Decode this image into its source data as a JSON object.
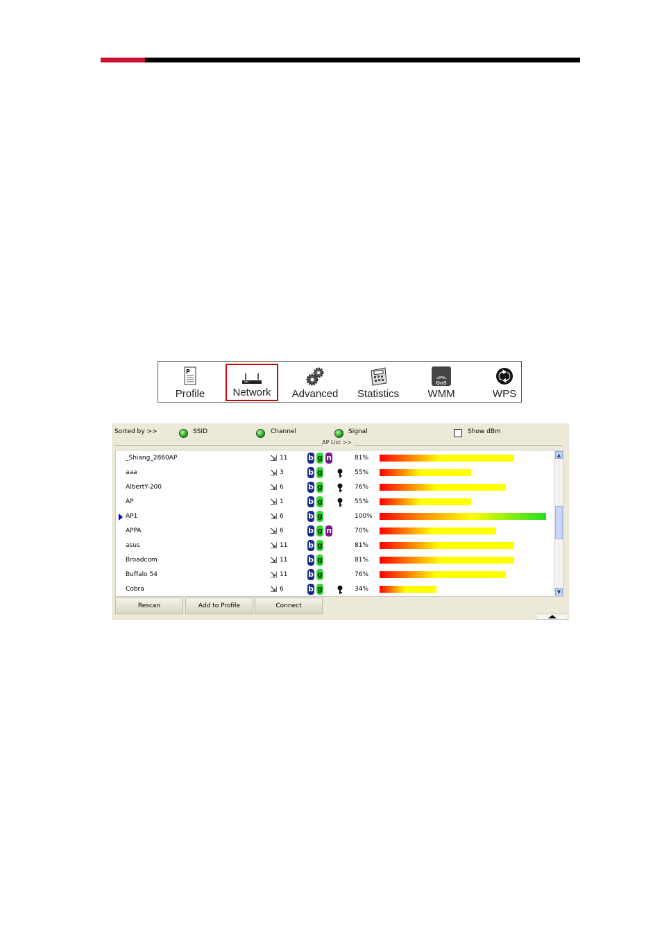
{
  "toolbar": {
    "items": [
      {
        "label": "Profile",
        "icon": "profile-icon"
      },
      {
        "label": "Network",
        "icon": "router-icon",
        "active": true
      },
      {
        "label": "Advanced",
        "icon": "gears-icon"
      },
      {
        "label": "Statistics",
        "icon": "calculator-icon"
      },
      {
        "label": "WMM",
        "icon": "qos-icon"
      },
      {
        "label": "WPS",
        "icon": "wps-icon"
      }
    ]
  },
  "sort": {
    "label": "Sorted by >>",
    "options": [
      "SSID",
      "Channel",
      "Signal"
    ],
    "show_dbm": "Show dBm"
  },
  "ap_list": {
    "title": "AP List >>",
    "rows": [
      {
        "ssid": "_Shiang_2860AP",
        "channel": "11",
        "b": true,
        "g": true,
        "n": true,
        "secure": false,
        "signal": "81%",
        "signal_value": 81
      },
      {
        "ssid": "aaa",
        "channel": "3",
        "b": true,
        "g": true,
        "n": false,
        "secure": true,
        "signal": "55%",
        "signal_value": 55
      },
      {
        "ssid": "AlbertY-200",
        "channel": "6",
        "b": true,
        "g": true,
        "n": false,
        "secure": true,
        "signal": "76%",
        "signal_value": 76
      },
      {
        "ssid": "AP",
        "channel": "1",
        "b": true,
        "g": true,
        "n": false,
        "secure": true,
        "signal": "55%",
        "signal_value": 55
      },
      {
        "ssid": "AP1",
        "channel": "6",
        "b": true,
        "g": true,
        "n": false,
        "secure": false,
        "signal": "100%",
        "signal_value": 100,
        "selected": true
      },
      {
        "ssid": "APPA",
        "channel": "6",
        "b": true,
        "g": true,
        "n": true,
        "secure": false,
        "signal": "70%",
        "signal_value": 70
      },
      {
        "ssid": "asus",
        "channel": "11",
        "b": true,
        "g": true,
        "n": false,
        "secure": false,
        "signal": "81%",
        "signal_value": 81
      },
      {
        "ssid": "Broadcom",
        "channel": "11",
        "b": true,
        "g": true,
        "n": false,
        "secure": false,
        "signal": "81%",
        "signal_value": 81
      },
      {
        "ssid": "Buffalo 54",
        "channel": "11",
        "b": true,
        "g": true,
        "n": false,
        "secure": false,
        "signal": "76%",
        "signal_value": 76
      },
      {
        "ssid": "Cobra",
        "channel": "6",
        "b": true,
        "g": true,
        "n": false,
        "secure": true,
        "signal": "34%",
        "signal_value": 34
      }
    ]
  },
  "buttons": {
    "rescan": "Rescan",
    "add_to_profile": "Add to Profile",
    "connect": "Connect"
  },
  "colors": {
    "header_red": "#c8102e",
    "active_border": "#d40000",
    "panel_bg": "#ece9d8"
  }
}
